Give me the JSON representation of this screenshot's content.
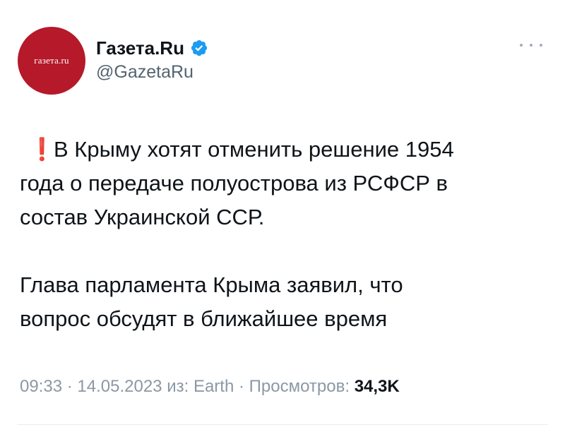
{
  "author": {
    "avatar_text": "газета.ru",
    "display_name": "Газета.Ru",
    "handle": "@GazetaRu",
    "verified": true
  },
  "post": {
    "paragraph1_icon": "❗",
    "paragraph1_lines": [
      "В Крыму хотят отменить решение 1954",
      "года о передаче полуострова из РСФСР в",
      "состав Украинской ССР."
    ],
    "paragraph2_lines": [
      "Глава парламента Крыма заявил, что",
      "вопрос обсудят в ближайшее время"
    ]
  },
  "meta": {
    "time": "09:33",
    "separator": " · ",
    "date": "14.05.2023",
    "source_prefix": "из:",
    "source": "Earth",
    "views_label": "Просмотров:",
    "views_count": "34,3K"
  },
  "colors": {
    "avatar_bg": "#b5192a",
    "verified_blue": "#1d9bf0",
    "exclaim_red": "#e0212a",
    "muted_text": "#536471"
  },
  "icons": {
    "verified": "verified-badge-icon",
    "more": "more-options-icon",
    "exclaim": "exclamation-icon"
  }
}
